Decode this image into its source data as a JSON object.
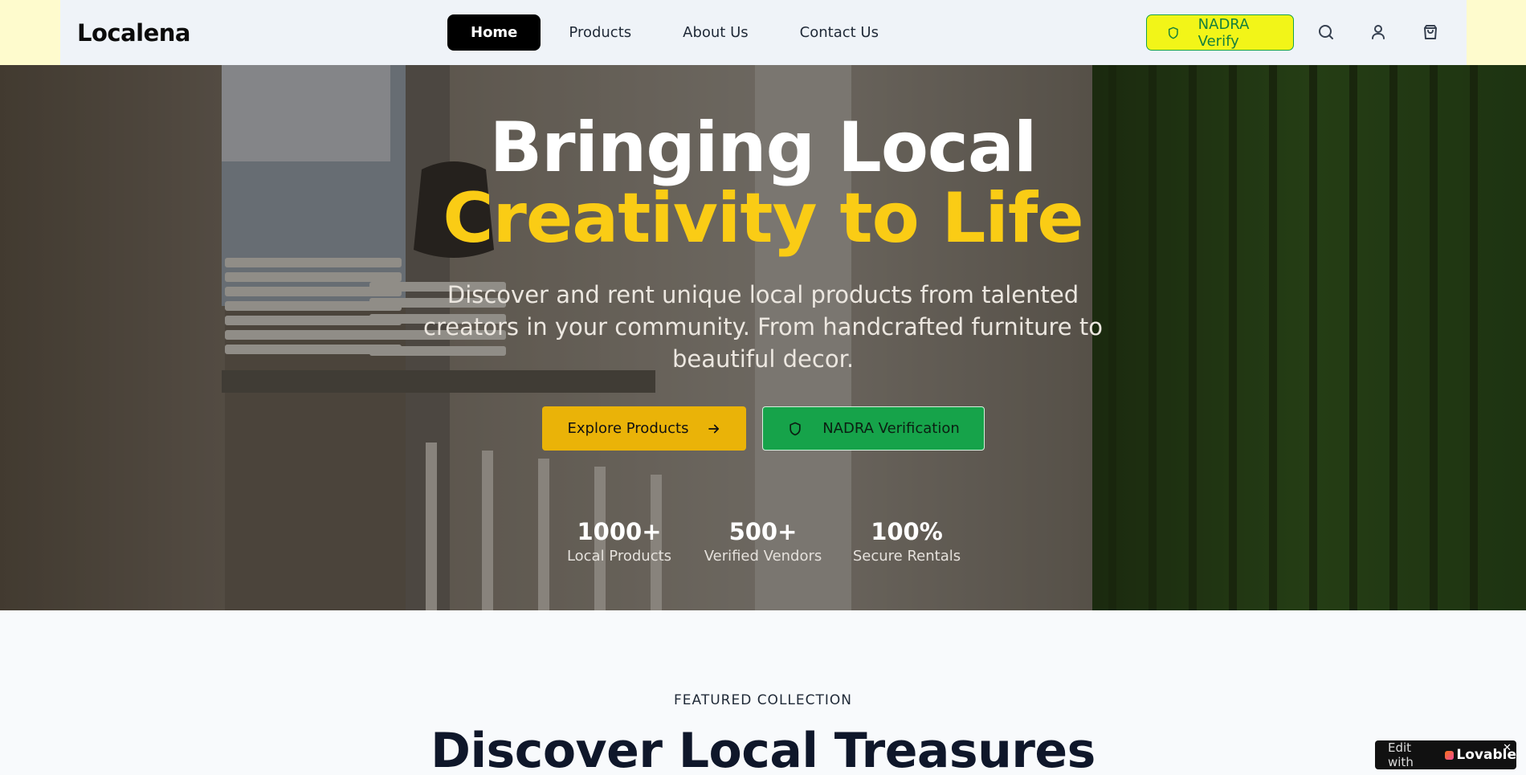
{
  "header": {
    "logo": "Localena",
    "nav": [
      {
        "label": "Home",
        "active": true
      },
      {
        "label": "Products",
        "active": false
      },
      {
        "label": "About Us",
        "active": false
      },
      {
        "label": "Contact Us",
        "active": false
      }
    ],
    "verify_label": "NADRA Verify",
    "icons": [
      "shield-icon",
      "search-icon",
      "user-icon",
      "shopping-bag-icon"
    ]
  },
  "hero": {
    "title_line1": "Bringing Local",
    "title_line2": "Creativity to Life",
    "subtitle": "Discover and rent unique local products from talented creators in your community. From handcrafted furniture to beautiful decor.",
    "explore_label": "Explore Products",
    "nadra_label": "NADRA Verification",
    "stats": [
      {
        "value": "1000+",
        "label": "Local Products"
      },
      {
        "value": "500+",
        "label": "Verified Vendors"
      },
      {
        "value": "100%",
        "label": "Secure Rentals"
      }
    ]
  },
  "featured": {
    "eyebrow": "FEATURED COLLECTION",
    "title": "Discover Local Treasures"
  },
  "badge": {
    "prefix": "Edit with",
    "brand": "Lovable",
    "close": "✕"
  },
  "colors": {
    "accent_yellow": "#facc15",
    "button_yellow": "#eab308",
    "verify_green": "#16a34a",
    "verify_bg": "#f2f518"
  }
}
